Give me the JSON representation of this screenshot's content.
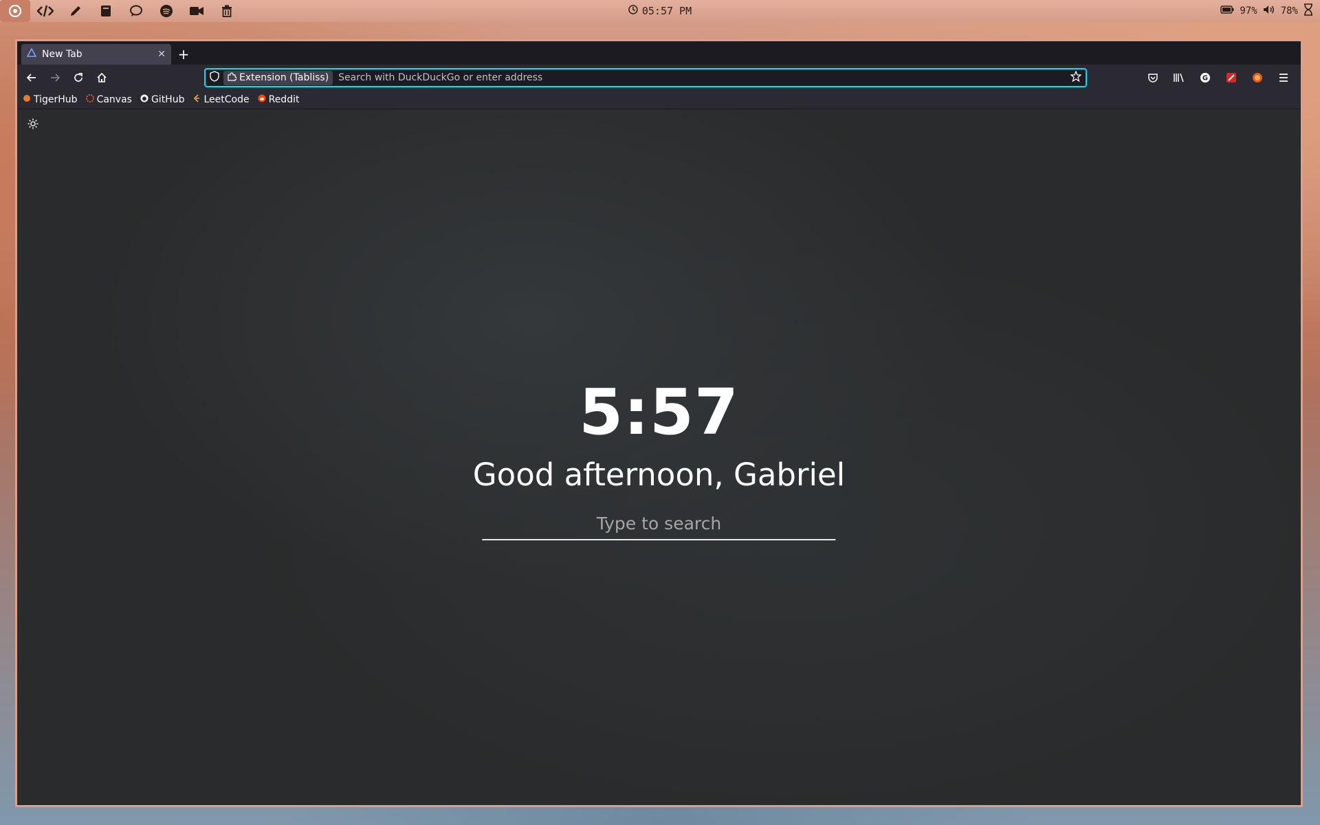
{
  "system_bar": {
    "launcher_icons": [
      "app-launcher-icon",
      "code-icon",
      "pencil-icon",
      "notebook-icon",
      "chat-icon",
      "spotify-icon",
      "video-icon",
      "trash-icon"
    ],
    "clock": "05:57 PM",
    "battery": "97%",
    "volume": "78%"
  },
  "browser": {
    "tab": {
      "title": "New Tab"
    },
    "newtab_label": "+",
    "identity_label": "Extension (Tabliss)",
    "url_placeholder": "Search with DuckDuckGo or enter address",
    "bookmarks": [
      "TigerHub",
      "Canvas",
      "GitHub",
      "LeetCode",
      "Reddit"
    ]
  },
  "page": {
    "time": "5:57",
    "greeting": "Good afternoon, Gabriel",
    "search_placeholder": "Type to search"
  },
  "colors": {
    "accent": "#00ddff",
    "window_border": "#d8a08e",
    "toolbar_bg": "#2b2a33",
    "tabbar_bg": "#1c1b22"
  }
}
